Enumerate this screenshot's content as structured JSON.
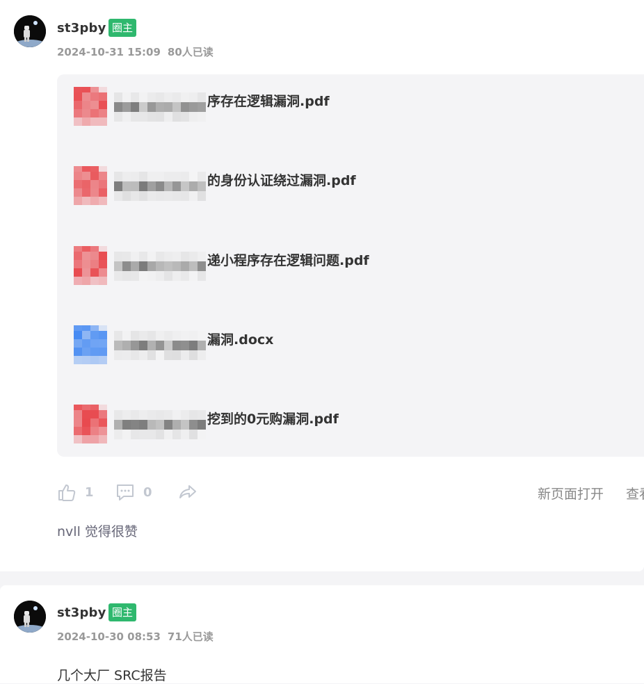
{
  "posts": [
    {
      "author": "st3pby",
      "badge": "圈主",
      "date": "2024-10-31 15:09",
      "reads": "80人已读",
      "files": [
        {
          "name": "序存在逻辑漏洞.pdf",
          "type": "pdf"
        },
        {
          "name": "的身份认证绕过漏洞.pdf",
          "type": "pdf"
        },
        {
          "name": "递小程序存在逻辑问题.pdf",
          "type": "pdf"
        },
        {
          "name": "漏洞.docx",
          "type": "docx"
        },
        {
          "name": "挖到的0元购漏洞.pdf",
          "type": "pdf"
        }
      ],
      "actions": {
        "like_count": "1",
        "comment_count": "0",
        "open_new_page": "新页面打开",
        "view": "查看"
      },
      "liked_by": "nvll 觉得很赞"
    },
    {
      "author": "st3pby",
      "badge": "圈主",
      "date": "2024-10-30 08:53",
      "reads": "71人已读",
      "text": "几个大厂 SRC报告"
    }
  ],
  "colors": {
    "badge": "#2fb86e",
    "pdf": "#e84a4f",
    "docx": "#3f86f2",
    "panel": "#f4f4f6"
  },
  "icons": [
    "avatar-astronaut",
    "pdf-file-icon",
    "docx-file-icon",
    "thumbs-up-icon",
    "comment-icon",
    "share-icon"
  ]
}
